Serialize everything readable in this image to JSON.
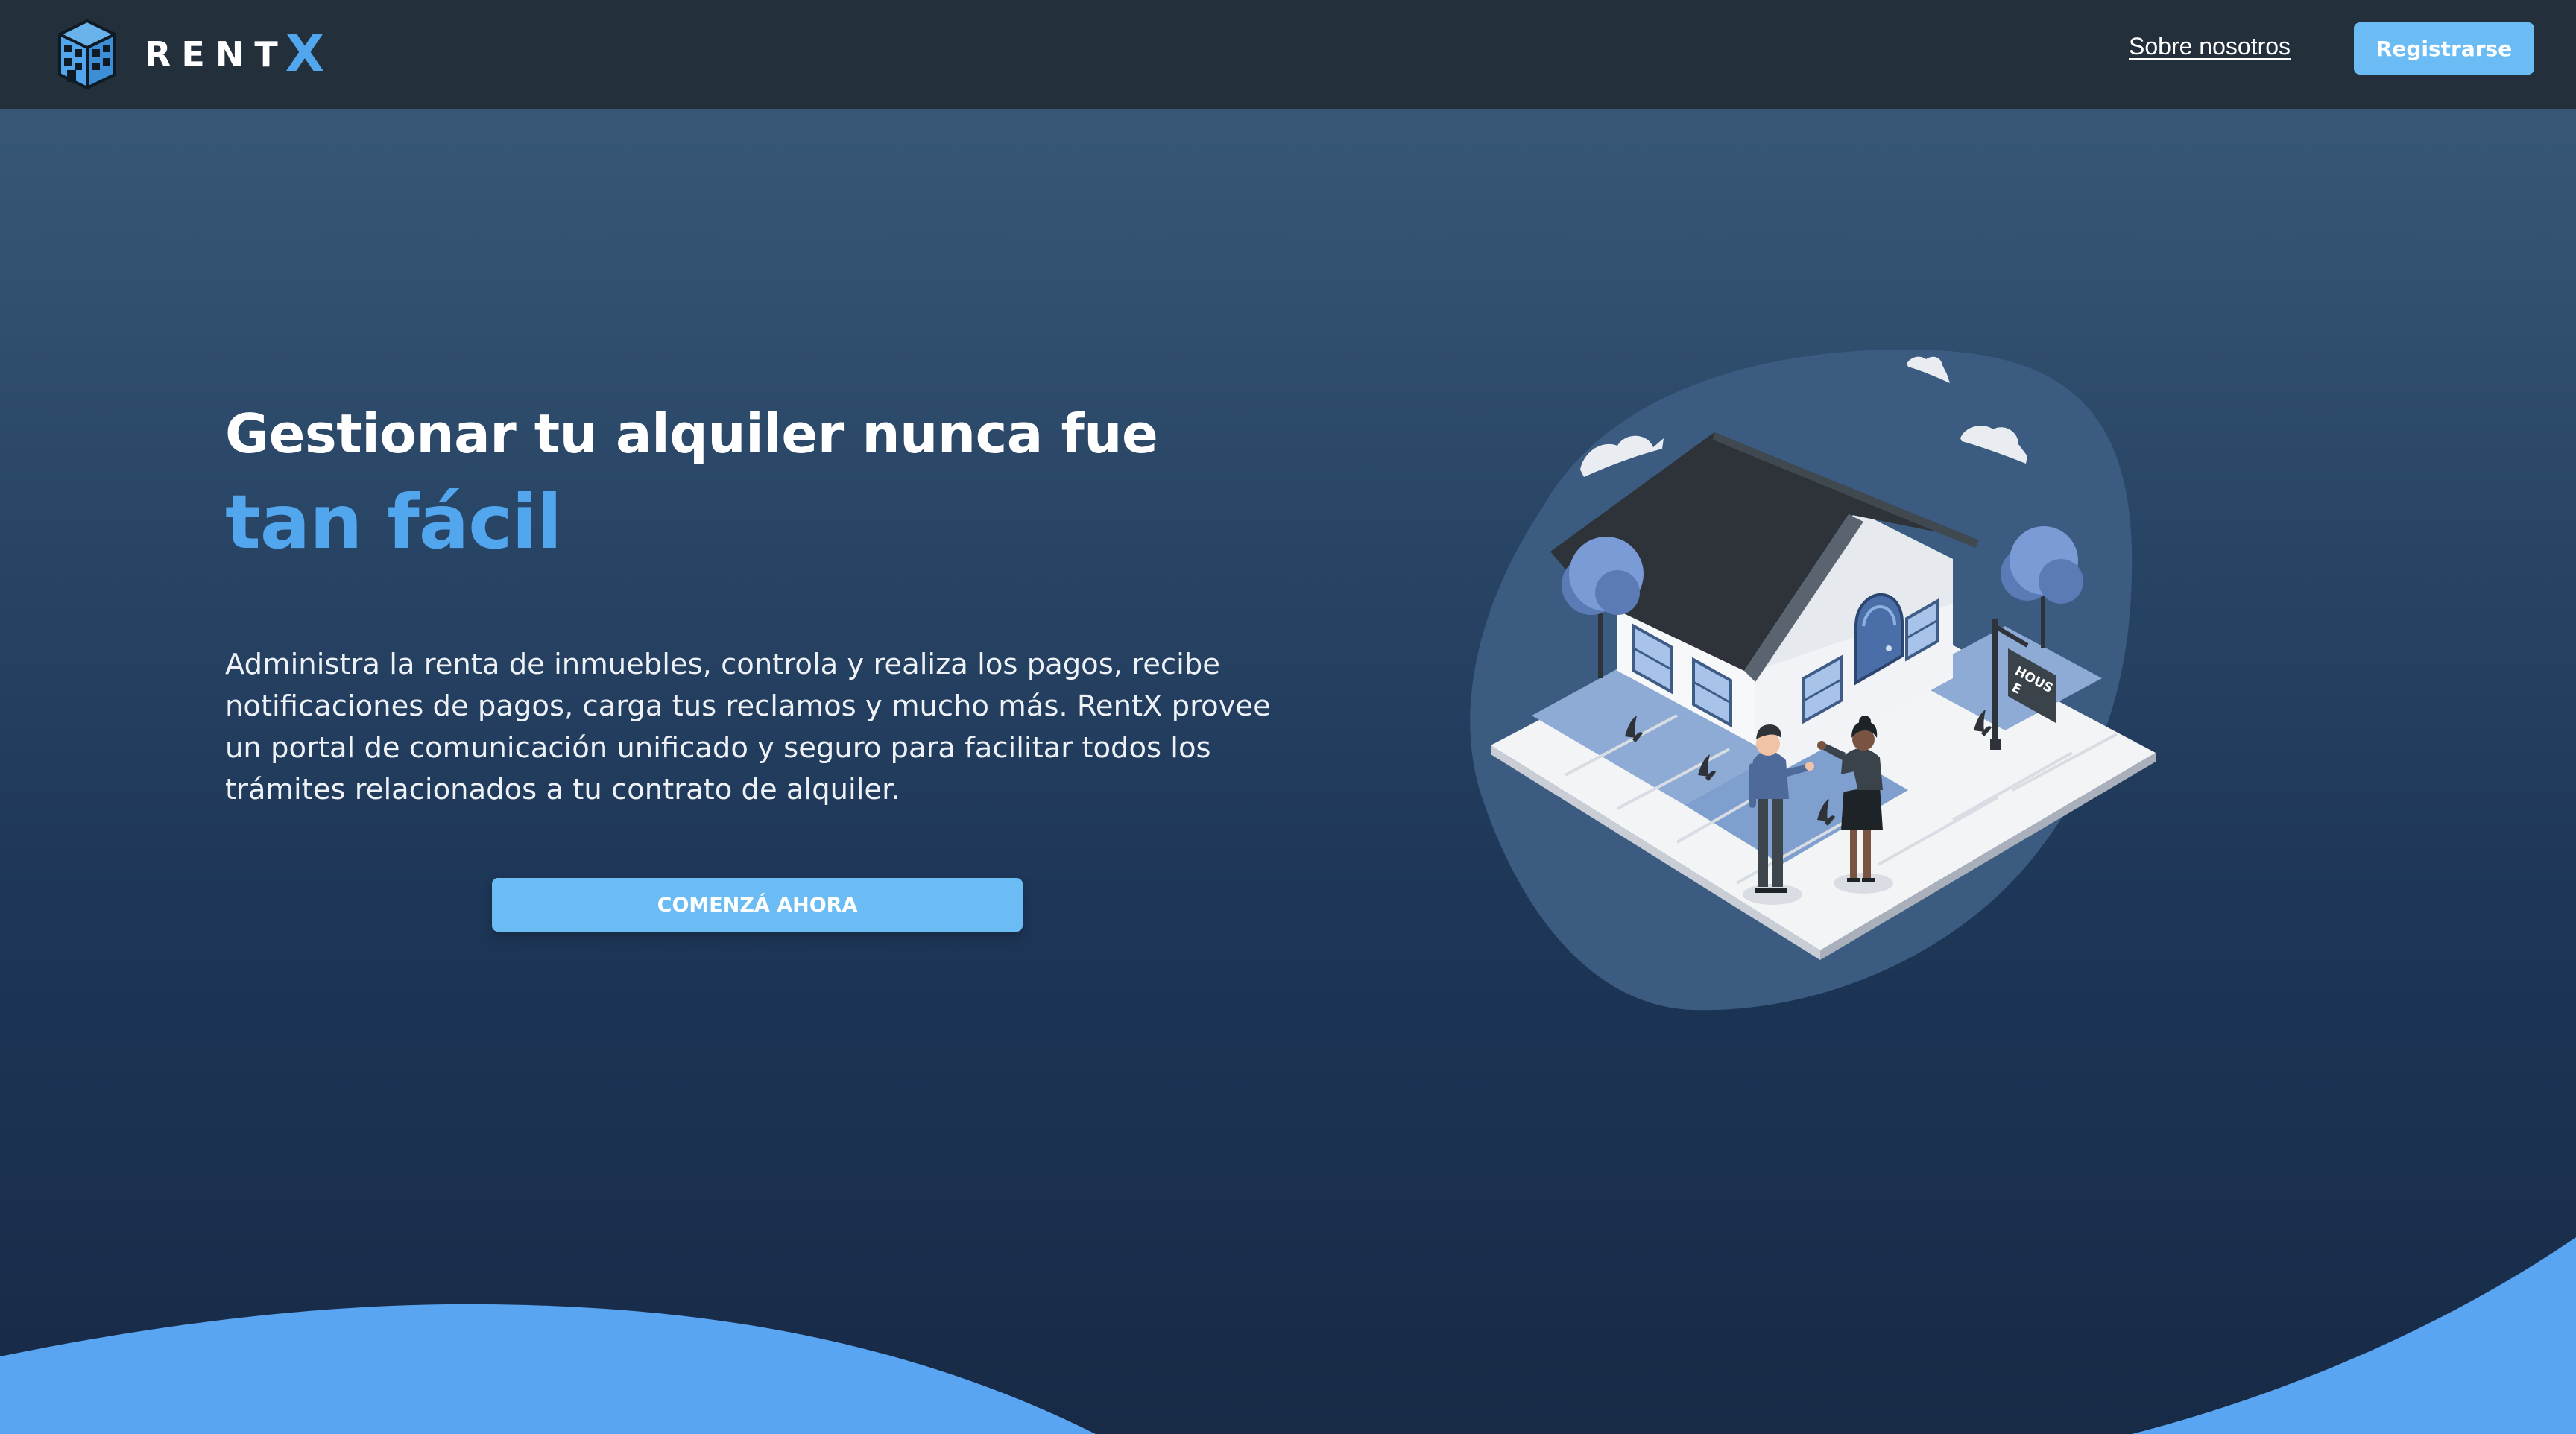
{
  "header": {
    "brand_name": "RENT",
    "brand_accent": "X",
    "logo_icon": "building-icon",
    "about_label": "Sobre nosotros",
    "register_label": "Registrarse"
  },
  "hero": {
    "title": "Gestionar tu alquiler nunca fue",
    "title_accent": "tan fácil",
    "description": "Administra la renta de inmuebles, controla y realiza los pagos, recibe notificaciones de pagos, carga tus reclamos y mucho más. RentX provee un portal de comunicación unificado y seguro para facilitar todos los trámites relacionados a tu contrato de alquiler.",
    "cta_label": "COMENZÁ AHORA"
  },
  "illustration": {
    "sign_text_1": "HOUS",
    "sign_text_2": "E"
  },
  "colors": {
    "navbar": "#232f3a",
    "accent": "#52a6ee",
    "button": "#6bbcf4",
    "wave": "#5aa5f2",
    "hero_top": "#3c5c7b",
    "hero_bottom": "#172a46"
  }
}
